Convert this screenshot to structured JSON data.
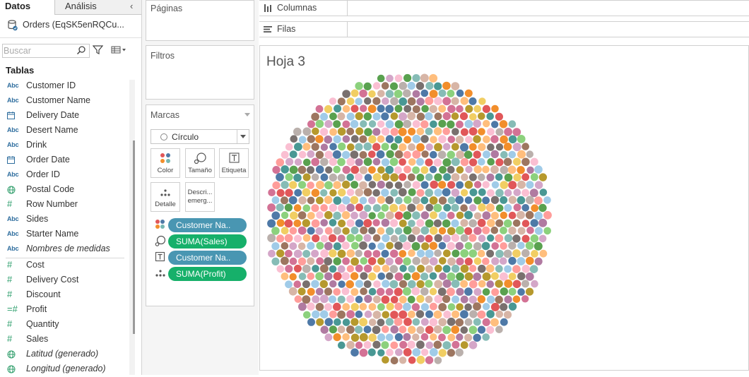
{
  "left_pane": {
    "tab_data": "Datos",
    "tab_analysis": "Análisis",
    "datasource": "Orders (EqSK5enRQCu...",
    "search_placeholder": "Buscar",
    "tables_heading": "Tablas",
    "dimensions": [
      {
        "type": "abc",
        "label": "Customer ID",
        "italic": false
      },
      {
        "type": "abc",
        "label": "Customer Name",
        "italic": false
      },
      {
        "type": "date",
        "label": "Delivery Date",
        "italic": false
      },
      {
        "type": "abc",
        "label": "Desert Name",
        "italic": false
      },
      {
        "type": "abc",
        "label": "Drink",
        "italic": false
      },
      {
        "type": "date",
        "label": "Order Date",
        "italic": false
      },
      {
        "type": "abc",
        "label": "Order ID",
        "italic": false
      },
      {
        "type": "globe",
        "label": "Postal Code",
        "italic": false
      },
      {
        "type": "hash",
        "label": "Row Number",
        "italic": false
      },
      {
        "type": "abc",
        "label": "Sides",
        "italic": false
      },
      {
        "type": "abc",
        "label": "Starter Name",
        "italic": false
      },
      {
        "type": "abc",
        "label": "Nombres de medidas",
        "italic": true
      }
    ],
    "measures": [
      {
        "type": "hash",
        "label": "Cost",
        "italic": false
      },
      {
        "type": "hash",
        "label": "Delivery Cost",
        "italic": false
      },
      {
        "type": "hash",
        "label": "Discount",
        "italic": false
      },
      {
        "type": "calc",
        "label": "Profit",
        "italic": false
      },
      {
        "type": "hash",
        "label": "Quantity",
        "italic": false
      },
      {
        "type": "hash",
        "label": "Sales",
        "italic": false
      },
      {
        "type": "globe",
        "label": "Latitud (generado)",
        "italic": true
      },
      {
        "type": "globe",
        "label": "Longitud (generado)",
        "italic": true
      }
    ]
  },
  "cards": {
    "pages": "Páginas",
    "filters": "Filtros",
    "marks": "Marcas"
  },
  "marks_card": {
    "mark_type": "Círculo",
    "buttons": {
      "color": "Color",
      "size": "Tamaño",
      "label": "Etiqueta",
      "detail": "Detalle",
      "tooltip_line1": "Descri...",
      "tooltip_line2": "emerg..."
    },
    "pills": [
      {
        "icon": "color",
        "label": "Customer Na..",
        "kind": "dimension"
      },
      {
        "icon": "size",
        "label": "SUMA(Sales)",
        "kind": "measure"
      },
      {
        "icon": "label",
        "label": "Customer Na..",
        "kind": "dimension"
      },
      {
        "icon": "detail",
        "label": "SUMA(Profit)",
        "kind": "measure"
      }
    ]
  },
  "shelves": {
    "columns": "Columnas",
    "rows": "Filas"
  },
  "sheet": {
    "title": "Hoja 3"
  },
  "colors": {
    "dimension_pill": "#4996b2",
    "measure_pill": "#16b06a",
    "bubble_palette": [
      "#4e79a7",
      "#a0cbe8",
      "#f28e2b",
      "#ffbe7d",
      "#59a14f",
      "#8cd17d",
      "#b6992d",
      "#f1ce63",
      "#499894",
      "#86bcb6",
      "#e15759",
      "#ff9d9a",
      "#79706e",
      "#bab0ac",
      "#d37295",
      "#fabfd2",
      "#b07aa1",
      "#d4a6c8",
      "#9d7660",
      "#d7b5a6"
    ]
  }
}
